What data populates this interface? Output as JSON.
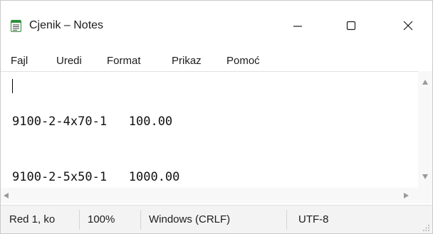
{
  "window": {
    "title": "Cjenik – Notes",
    "app_icon": "notepad-icon",
    "controls": [
      "minimize-icon",
      "maximize-icon",
      "close-icon"
    ]
  },
  "menu": {
    "items": [
      "Fajl",
      "Uredi",
      "Format",
      "Prikaz",
      "Pomoć"
    ]
  },
  "editor": {
    "lines": [
      "9100-2-4x70-1   100.00",
      "9100-2-5x50-1   1000.00"
    ]
  },
  "status": {
    "position": "Red 1, ko",
    "zoom": "100%",
    "line_ending": "Windows (CRLF)",
    "encoding": "UTF-8"
  },
  "colors": {
    "accent": "#2f8f3a",
    "text": "#1c1c1c",
    "statusbar": "#f3f3f3"
  }
}
